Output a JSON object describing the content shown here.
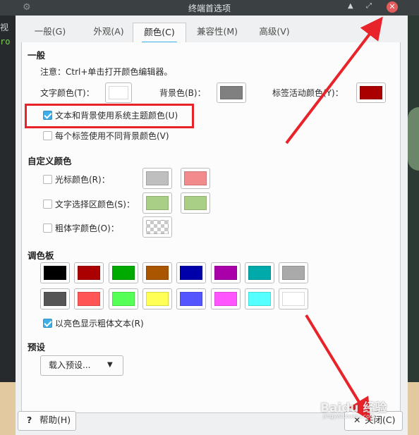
{
  "window": {
    "title": "终端首选项",
    "minimize_glyph": "▲",
    "restore_glyph": "⤢",
    "close_glyph": "✕"
  },
  "background": {
    "text1": "视",
    "text2": "ro"
  },
  "tabs": [
    {
      "label": "一般(G)",
      "active": false
    },
    {
      "label": "外观(A)",
      "active": false
    },
    {
      "label": "颜色(C)",
      "active": true
    },
    {
      "label": "兼容性(M)",
      "active": false
    },
    {
      "label": "高级(V)",
      "active": false
    }
  ],
  "general": {
    "heading": "一般",
    "note": "注意：Ctrl+单击打开颜色编辑器。",
    "text_color_label": "文字颜色(T)：",
    "text_color": "#ffffff",
    "bg_color_label": "背景色(B)：",
    "bg_color": "#808080",
    "tab_active_label": "标签活动颜色(Y)：",
    "tab_active_color": "#aa0000",
    "use_theme_label": "文本和背景使用系统主题颜色(U)",
    "use_theme_checked": true,
    "per_tab_label": "每个标签使用不同背景颜色(V)",
    "per_tab_checked": false
  },
  "custom": {
    "heading": "自定义颜色",
    "cursor_label": "光标颜色(R)：",
    "cursor_colors": [
      "#bfbfbf",
      "#f28b8b"
    ],
    "selection_label": "文字选择区颜色(S)：",
    "selection_colors": [
      "#a9cf86",
      "#a9cf86"
    ],
    "bold_label": "粗体字颜色(O)："
  },
  "palette": {
    "heading": "调色板",
    "row1": [
      "#000000",
      "#aa0000",
      "#00aa00",
      "#aa5500",
      "#0000aa",
      "#aa00aa",
      "#00aaaa",
      "#aaaaaa"
    ],
    "row2": [
      "#555555",
      "#ff5555",
      "#55ff55",
      "#ffff55",
      "#5555ff",
      "#ff55ff",
      "#55ffff",
      "#ffffff"
    ],
    "bright_bold_label": "以亮色显示粗体文本(R)",
    "bright_bold_checked": true
  },
  "presets": {
    "heading": "预设",
    "load_label": "载入预设..."
  },
  "footer": {
    "help_label": "帮助(H)",
    "close_label": "关闭(C)"
  },
  "annotation": {
    "color": "#e8232a",
    "watermark_main": "Baidu 经验",
    "watermark_sub": "jingyan.baidu.com"
  }
}
